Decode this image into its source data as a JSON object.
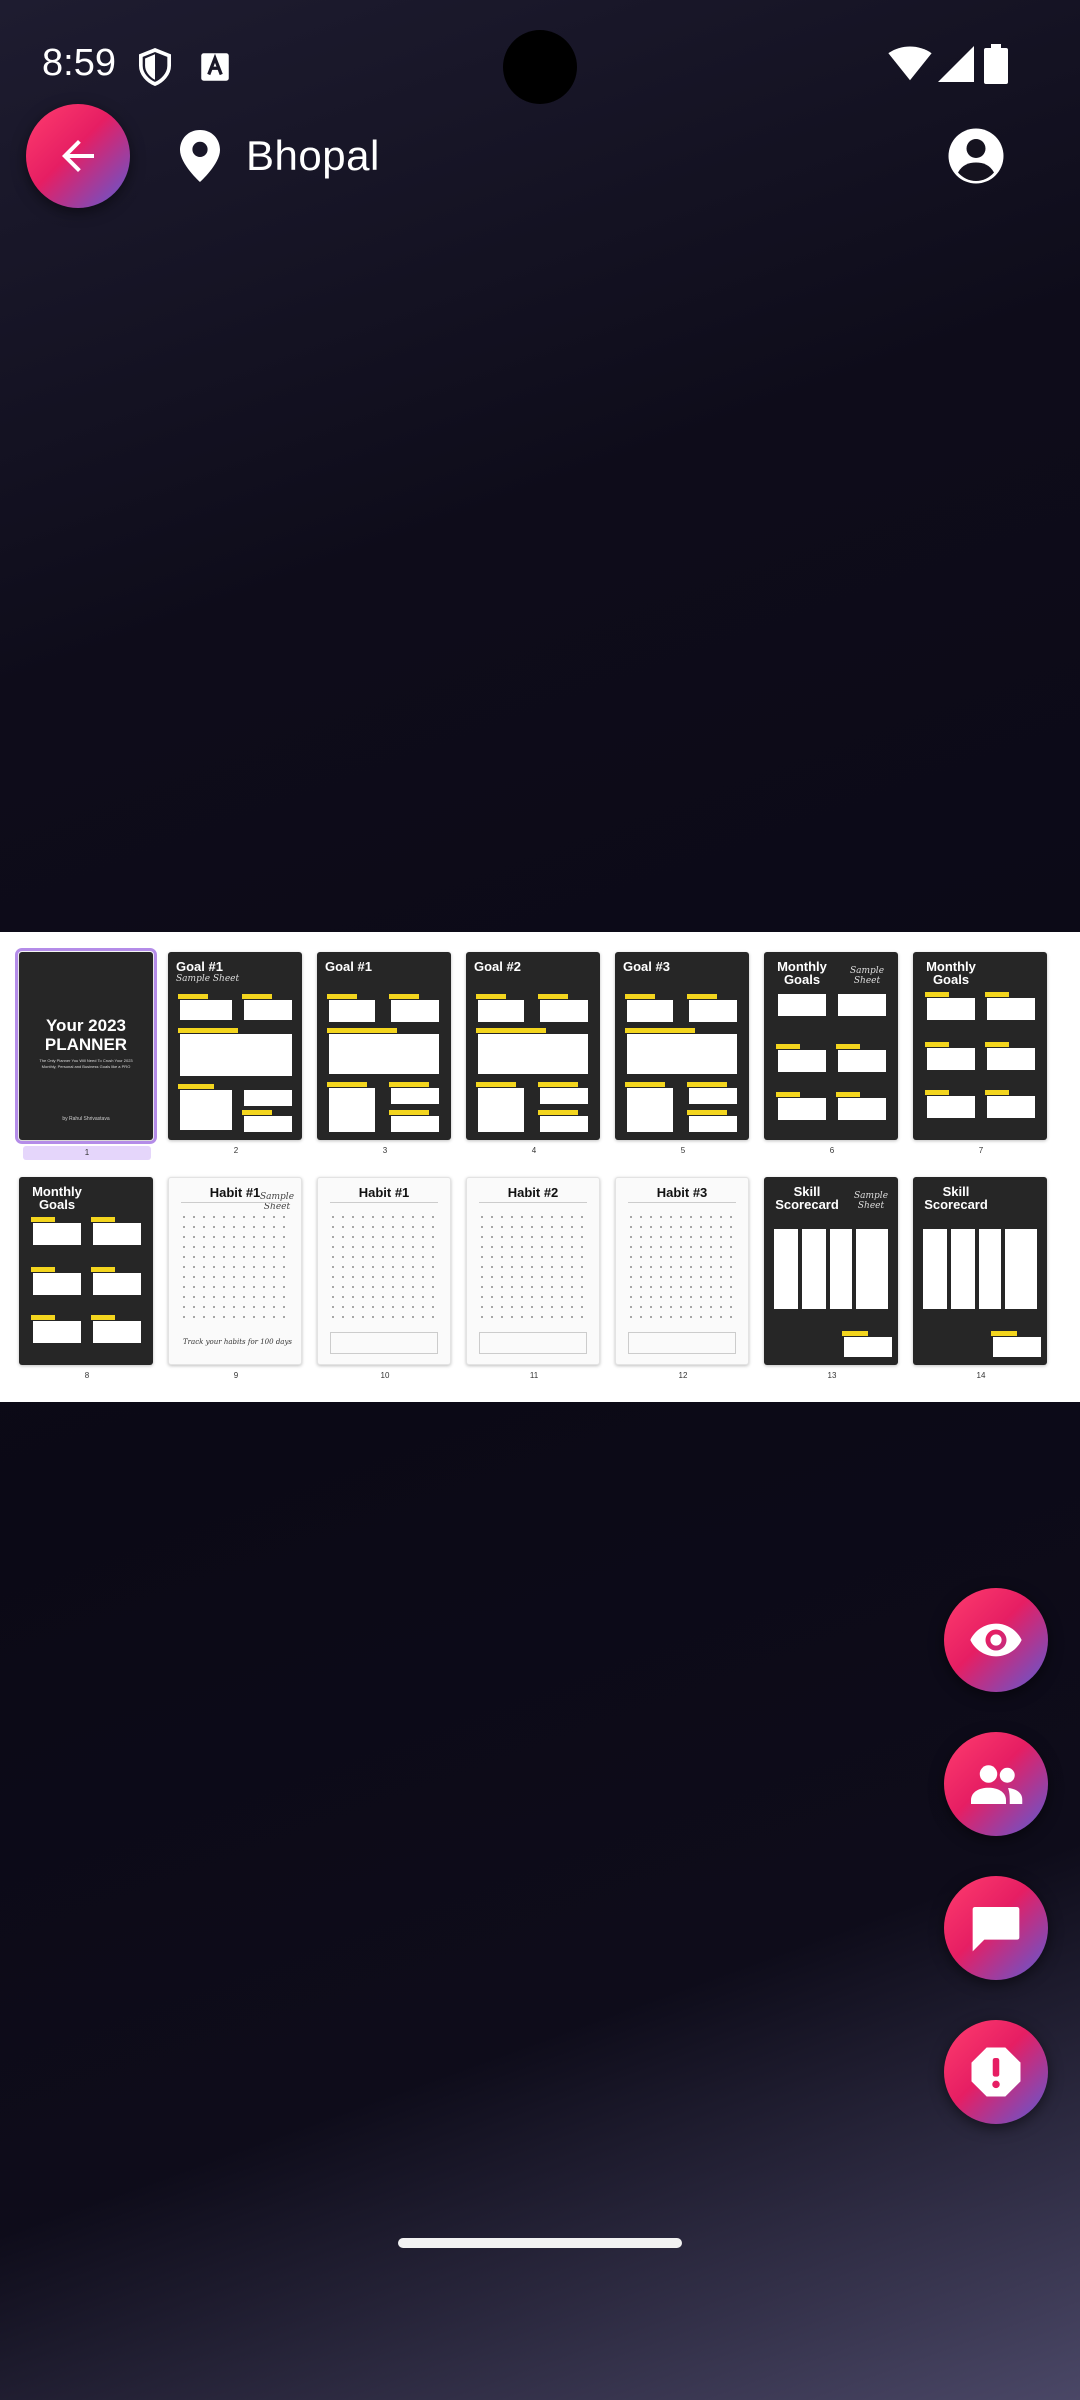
{
  "status_bar": {
    "time": "8:59"
  },
  "header": {
    "location": "Bhopal"
  },
  "pages": [
    {
      "num": "1",
      "title": "Your 2023 PLANNER",
      "subtitle": "The Only Planner You Will Need To Crush Your 2023 Monthly, Personal and Business Goals like a PRO",
      "byline": "by Rahul Shrivastava"
    },
    {
      "num": "2",
      "title": "Goal #1",
      "script": "Sample Sheet"
    },
    {
      "num": "3",
      "title": "Goal #1"
    },
    {
      "num": "4",
      "title": "Goal #2"
    },
    {
      "num": "5",
      "title": "Goal #3"
    },
    {
      "num": "6",
      "title": "Monthly Goals",
      "script": "Sample Sheet"
    },
    {
      "num": "7",
      "title": "Monthly Goals"
    },
    {
      "num": "8",
      "title": "Monthly Goals"
    },
    {
      "num": "9",
      "title": "Habit #1",
      "script": "Sample Sheet",
      "note": "Track your habits for 100 days"
    },
    {
      "num": "10",
      "title": "Habit #1"
    },
    {
      "num": "11",
      "title": "Habit #2"
    },
    {
      "num": "12",
      "title": "Habit #3"
    },
    {
      "num": "13",
      "title": "Skill Scorecard",
      "script": "Sample Sheet"
    },
    {
      "num": "14",
      "title": "Skill Scorecard"
    }
  ],
  "fabs": [
    {
      "icon": "eye-icon"
    },
    {
      "icon": "people-icon"
    },
    {
      "icon": "chat-icon"
    },
    {
      "icon": "report-icon"
    }
  ],
  "colors": {
    "accent_pink": "#e61e63",
    "accent_blue": "#5a5bd6",
    "highlight_yellow": "#f3d51e",
    "selection_purple": "#b48ce8"
  }
}
